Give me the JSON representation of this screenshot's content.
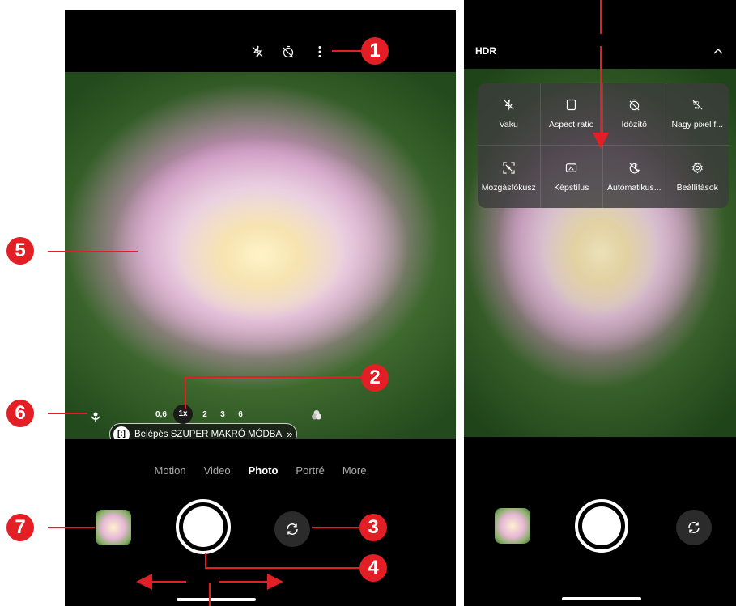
{
  "left_screen": {
    "modes": [
      "Motion",
      "Video",
      "Photo",
      "Portré",
      "More"
    ],
    "selected_mode": "Photo",
    "macro_pill_label": "Belépés SZUPER MAKRÓ MÓDBA",
    "zoom_levels": [
      "0,6",
      "1x",
      "2",
      "3",
      "6"
    ],
    "active_zoom": "1x"
  },
  "right_screen": {
    "hdr_label": "HDR",
    "menu_items": [
      {
        "label": "Vaku",
        "icon": "flash-off-icon"
      },
      {
        "label": "Aspect ratio",
        "icon": "aspect-ratio-icon"
      },
      {
        "label": "Időzítő",
        "icon": "timer-off-icon"
      },
      {
        "label": "Nagy pixel f...",
        "icon": "high-pixel-icon"
      },
      {
        "label": "Mozgásfókusz",
        "icon": "motion-focus-icon"
      },
      {
        "label": "Képstílus",
        "icon": "photo-style-icon"
      },
      {
        "label": "Automatikus...",
        "icon": "auto-night-icon"
      },
      {
        "label": "Beállítások",
        "icon": "gear-icon"
      }
    ]
  },
  "callouts": [
    "1",
    "2",
    "3",
    "4",
    "5",
    "6",
    "7"
  ],
  "colors": {
    "callout": "#e31e24",
    "arrow": "#e31e24"
  }
}
